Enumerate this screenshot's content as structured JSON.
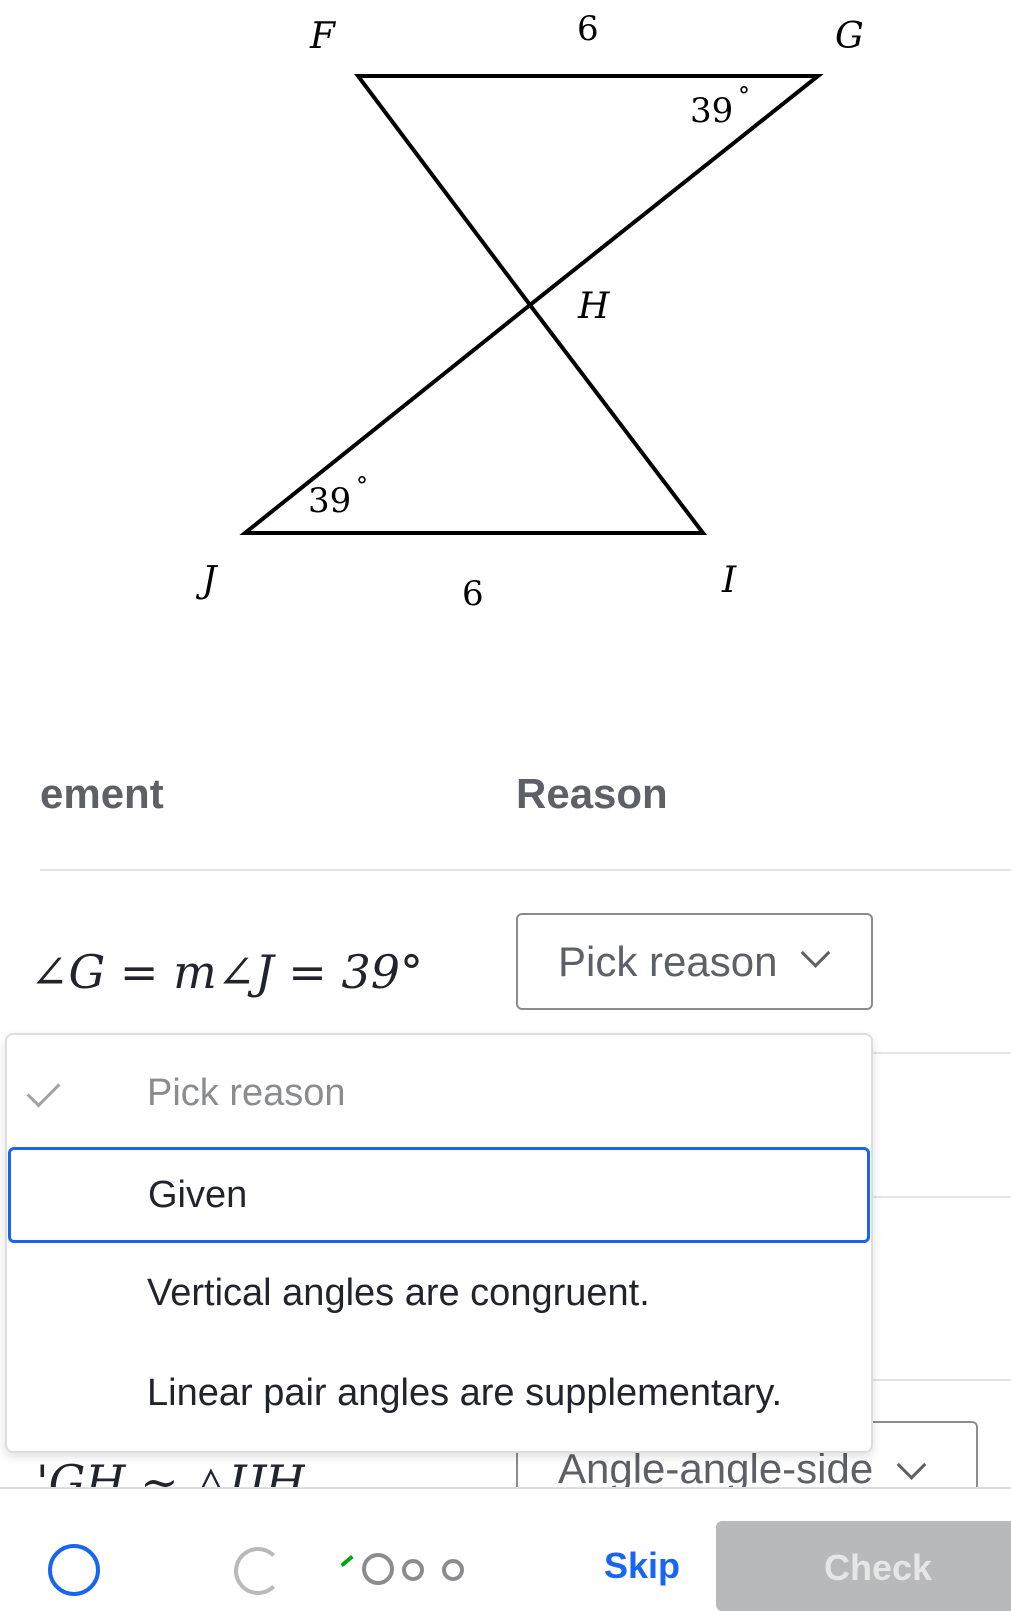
{
  "diagram": {
    "points": {
      "F": "F",
      "G": "G",
      "H": "H",
      "I": "I",
      "J": "J"
    },
    "side_top": "6",
    "side_bottom": "6",
    "angle_G": "39",
    "angle_J": "39",
    "degree": "°"
  },
  "table": {
    "header_statement": "ement",
    "header_reason": "Reason",
    "rows": [
      {
        "statement": "∠G = m∠J = 39°",
        "reason": "Pick reason"
      },
      {
        "statement": "'GH ∼ △IJH",
        "reason": "Angle-angle-side"
      }
    ]
  },
  "menu": {
    "options": [
      {
        "label": "Pick reason",
        "selected": true
      },
      {
        "label": "Given",
        "focused": true
      },
      {
        "label": "Vertical angles are congruent."
      },
      {
        "label": "Linear pair angles are supplementary."
      }
    ]
  },
  "footer": {
    "skip": "Skip",
    "check": "Check"
  },
  "colors": {
    "accent": "#1865f2",
    "check_disabled": "#b8b9bb",
    "progress": "#00a60e"
  }
}
